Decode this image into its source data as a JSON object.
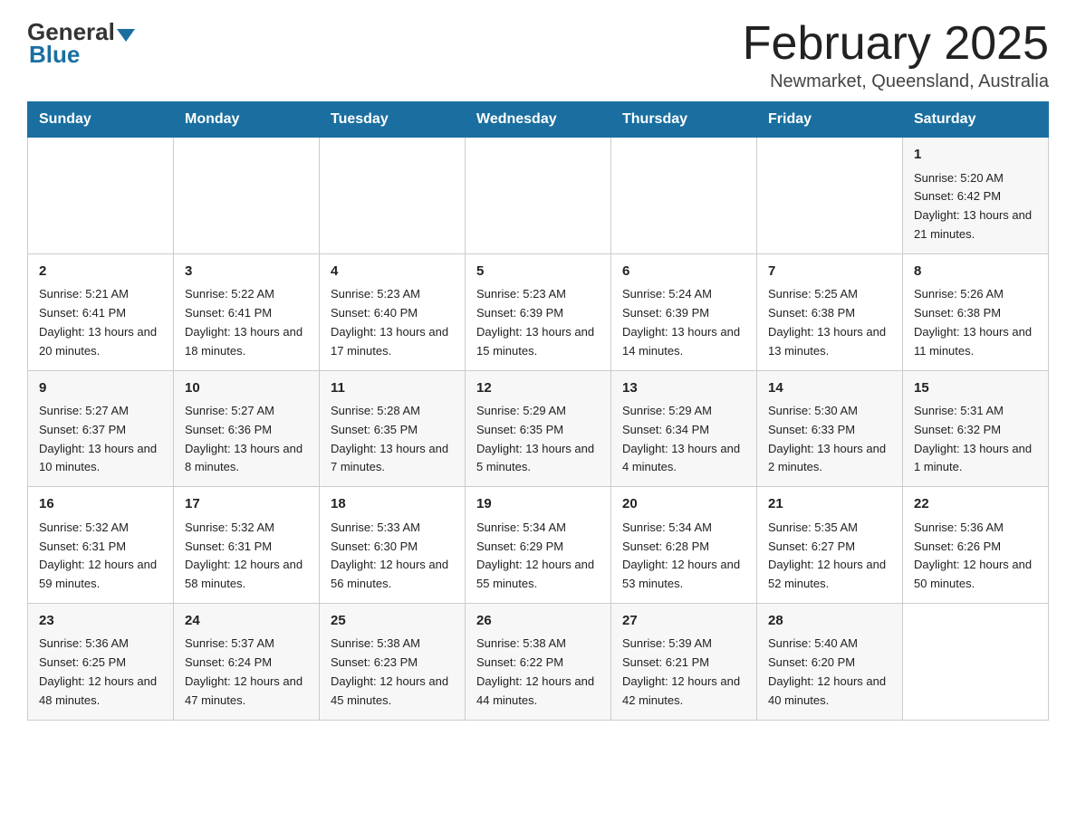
{
  "logo": {
    "general": "General",
    "blue": "Blue"
  },
  "header": {
    "title": "February 2025",
    "location": "Newmarket, Queensland, Australia"
  },
  "calendar": {
    "days": [
      "Sunday",
      "Monday",
      "Tuesday",
      "Wednesday",
      "Thursday",
      "Friday",
      "Saturday"
    ],
    "weeks": [
      [
        {
          "day": "",
          "info": ""
        },
        {
          "day": "",
          "info": ""
        },
        {
          "day": "",
          "info": ""
        },
        {
          "day": "",
          "info": ""
        },
        {
          "day": "",
          "info": ""
        },
        {
          "day": "",
          "info": ""
        },
        {
          "day": "1",
          "info": "Sunrise: 5:20 AM\nSunset: 6:42 PM\nDaylight: 13 hours and 21 minutes."
        }
      ],
      [
        {
          "day": "2",
          "info": "Sunrise: 5:21 AM\nSunset: 6:41 PM\nDaylight: 13 hours and 20 minutes."
        },
        {
          "day": "3",
          "info": "Sunrise: 5:22 AM\nSunset: 6:41 PM\nDaylight: 13 hours and 18 minutes."
        },
        {
          "day": "4",
          "info": "Sunrise: 5:23 AM\nSunset: 6:40 PM\nDaylight: 13 hours and 17 minutes."
        },
        {
          "day": "5",
          "info": "Sunrise: 5:23 AM\nSunset: 6:39 PM\nDaylight: 13 hours and 15 minutes."
        },
        {
          "day": "6",
          "info": "Sunrise: 5:24 AM\nSunset: 6:39 PM\nDaylight: 13 hours and 14 minutes."
        },
        {
          "day": "7",
          "info": "Sunrise: 5:25 AM\nSunset: 6:38 PM\nDaylight: 13 hours and 13 minutes."
        },
        {
          "day": "8",
          "info": "Sunrise: 5:26 AM\nSunset: 6:38 PM\nDaylight: 13 hours and 11 minutes."
        }
      ],
      [
        {
          "day": "9",
          "info": "Sunrise: 5:27 AM\nSunset: 6:37 PM\nDaylight: 13 hours and 10 minutes."
        },
        {
          "day": "10",
          "info": "Sunrise: 5:27 AM\nSunset: 6:36 PM\nDaylight: 13 hours and 8 minutes."
        },
        {
          "day": "11",
          "info": "Sunrise: 5:28 AM\nSunset: 6:35 PM\nDaylight: 13 hours and 7 minutes."
        },
        {
          "day": "12",
          "info": "Sunrise: 5:29 AM\nSunset: 6:35 PM\nDaylight: 13 hours and 5 minutes."
        },
        {
          "day": "13",
          "info": "Sunrise: 5:29 AM\nSunset: 6:34 PM\nDaylight: 13 hours and 4 minutes."
        },
        {
          "day": "14",
          "info": "Sunrise: 5:30 AM\nSunset: 6:33 PM\nDaylight: 13 hours and 2 minutes."
        },
        {
          "day": "15",
          "info": "Sunrise: 5:31 AM\nSunset: 6:32 PM\nDaylight: 13 hours and 1 minute."
        }
      ],
      [
        {
          "day": "16",
          "info": "Sunrise: 5:32 AM\nSunset: 6:31 PM\nDaylight: 12 hours and 59 minutes."
        },
        {
          "day": "17",
          "info": "Sunrise: 5:32 AM\nSunset: 6:31 PM\nDaylight: 12 hours and 58 minutes."
        },
        {
          "day": "18",
          "info": "Sunrise: 5:33 AM\nSunset: 6:30 PM\nDaylight: 12 hours and 56 minutes."
        },
        {
          "day": "19",
          "info": "Sunrise: 5:34 AM\nSunset: 6:29 PM\nDaylight: 12 hours and 55 minutes."
        },
        {
          "day": "20",
          "info": "Sunrise: 5:34 AM\nSunset: 6:28 PM\nDaylight: 12 hours and 53 minutes."
        },
        {
          "day": "21",
          "info": "Sunrise: 5:35 AM\nSunset: 6:27 PM\nDaylight: 12 hours and 52 minutes."
        },
        {
          "day": "22",
          "info": "Sunrise: 5:36 AM\nSunset: 6:26 PM\nDaylight: 12 hours and 50 minutes."
        }
      ],
      [
        {
          "day": "23",
          "info": "Sunrise: 5:36 AM\nSunset: 6:25 PM\nDaylight: 12 hours and 48 minutes."
        },
        {
          "day": "24",
          "info": "Sunrise: 5:37 AM\nSunset: 6:24 PM\nDaylight: 12 hours and 47 minutes."
        },
        {
          "day": "25",
          "info": "Sunrise: 5:38 AM\nSunset: 6:23 PM\nDaylight: 12 hours and 45 minutes."
        },
        {
          "day": "26",
          "info": "Sunrise: 5:38 AM\nSunset: 6:22 PM\nDaylight: 12 hours and 44 minutes."
        },
        {
          "day": "27",
          "info": "Sunrise: 5:39 AM\nSunset: 6:21 PM\nDaylight: 12 hours and 42 minutes."
        },
        {
          "day": "28",
          "info": "Sunrise: 5:40 AM\nSunset: 6:20 PM\nDaylight: 12 hours and 40 minutes."
        },
        {
          "day": "",
          "info": ""
        }
      ]
    ]
  }
}
